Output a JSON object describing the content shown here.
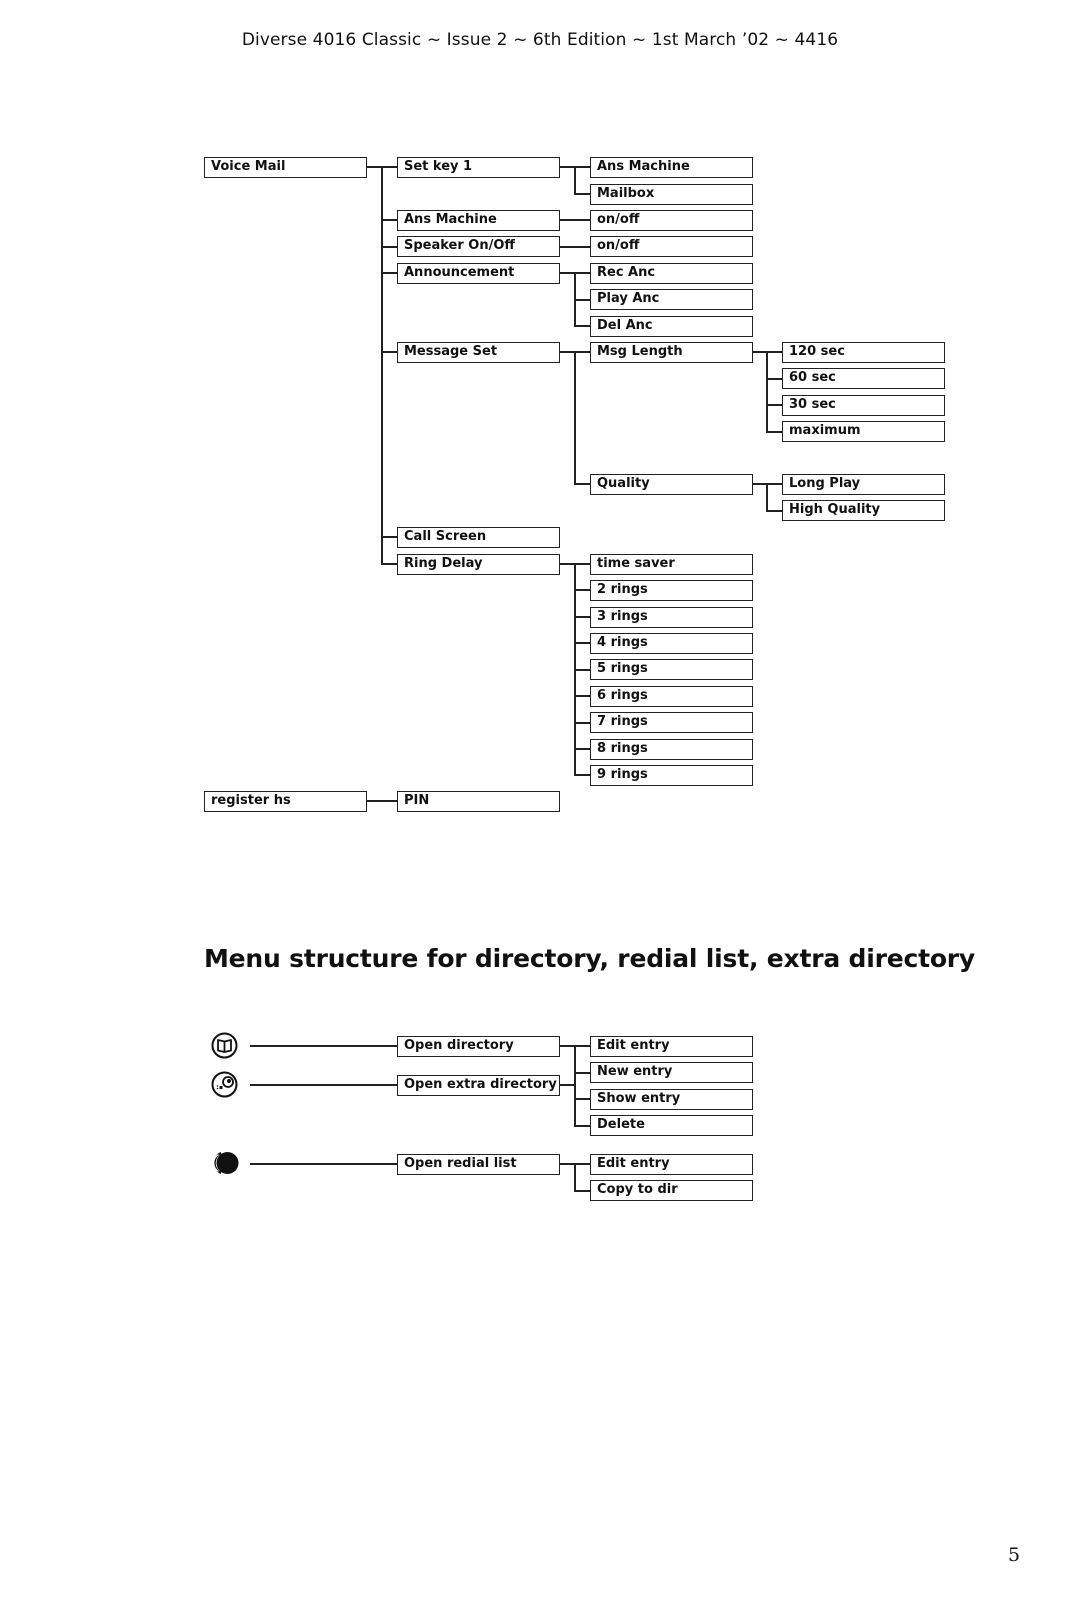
{
  "header": {
    "text": "Diverse 4016 Classic ~ Issue 2 ~ 6th Edition ~ 1st March ’02 ~ 4416"
  },
  "voice_mail_tree": {
    "root": "Voice Mail",
    "set_key_1": {
      "label": "Set key 1",
      "options": [
        "Ans Machine",
        "Mailbox"
      ]
    },
    "ans_machine": {
      "label": "Ans Machine",
      "options": [
        "on/off"
      ]
    },
    "speaker": {
      "label": "Speaker On/Off",
      "options": [
        "on/off"
      ]
    },
    "announcement": {
      "label": "Announcement",
      "options": [
        "Rec Anc",
        "Play Anc",
        "Del Anc"
      ]
    },
    "message_set": {
      "label": "Message Set",
      "msg_length": {
        "label": "Msg Length",
        "options": [
          "120 sec",
          "60 sec",
          "30 sec",
          "maximum"
        ]
      },
      "quality": {
        "label": "Quality",
        "options": [
          "Long Play",
          "High Quality"
        ]
      }
    },
    "call_screen": {
      "label": "Call Screen"
    },
    "ring_delay": {
      "label": "Ring Delay",
      "options": [
        "time saver",
        "2 rings",
        "3 rings",
        "4 rings",
        "5 rings",
        "6 rings",
        "7 rings",
        "8 rings",
        "9 rings"
      ]
    }
  },
  "register_tree": {
    "root": "register hs",
    "child": "PIN"
  },
  "section_title": "Menu structure for directory, redial list, extra directory",
  "directory_tree": {
    "icons": [
      "directory-book-icon",
      "extra-directory-icon",
      "redial-icon"
    ],
    "open_directory": "Open directory",
    "open_extra_directory": "Open extra directory",
    "directory_options": [
      "Edit entry",
      "New entry",
      "Show entry",
      "Delete"
    ],
    "open_redial_list": "Open redial list",
    "redial_options": [
      "Edit entry",
      "Copy to dir"
    ]
  },
  "page_number": "5"
}
